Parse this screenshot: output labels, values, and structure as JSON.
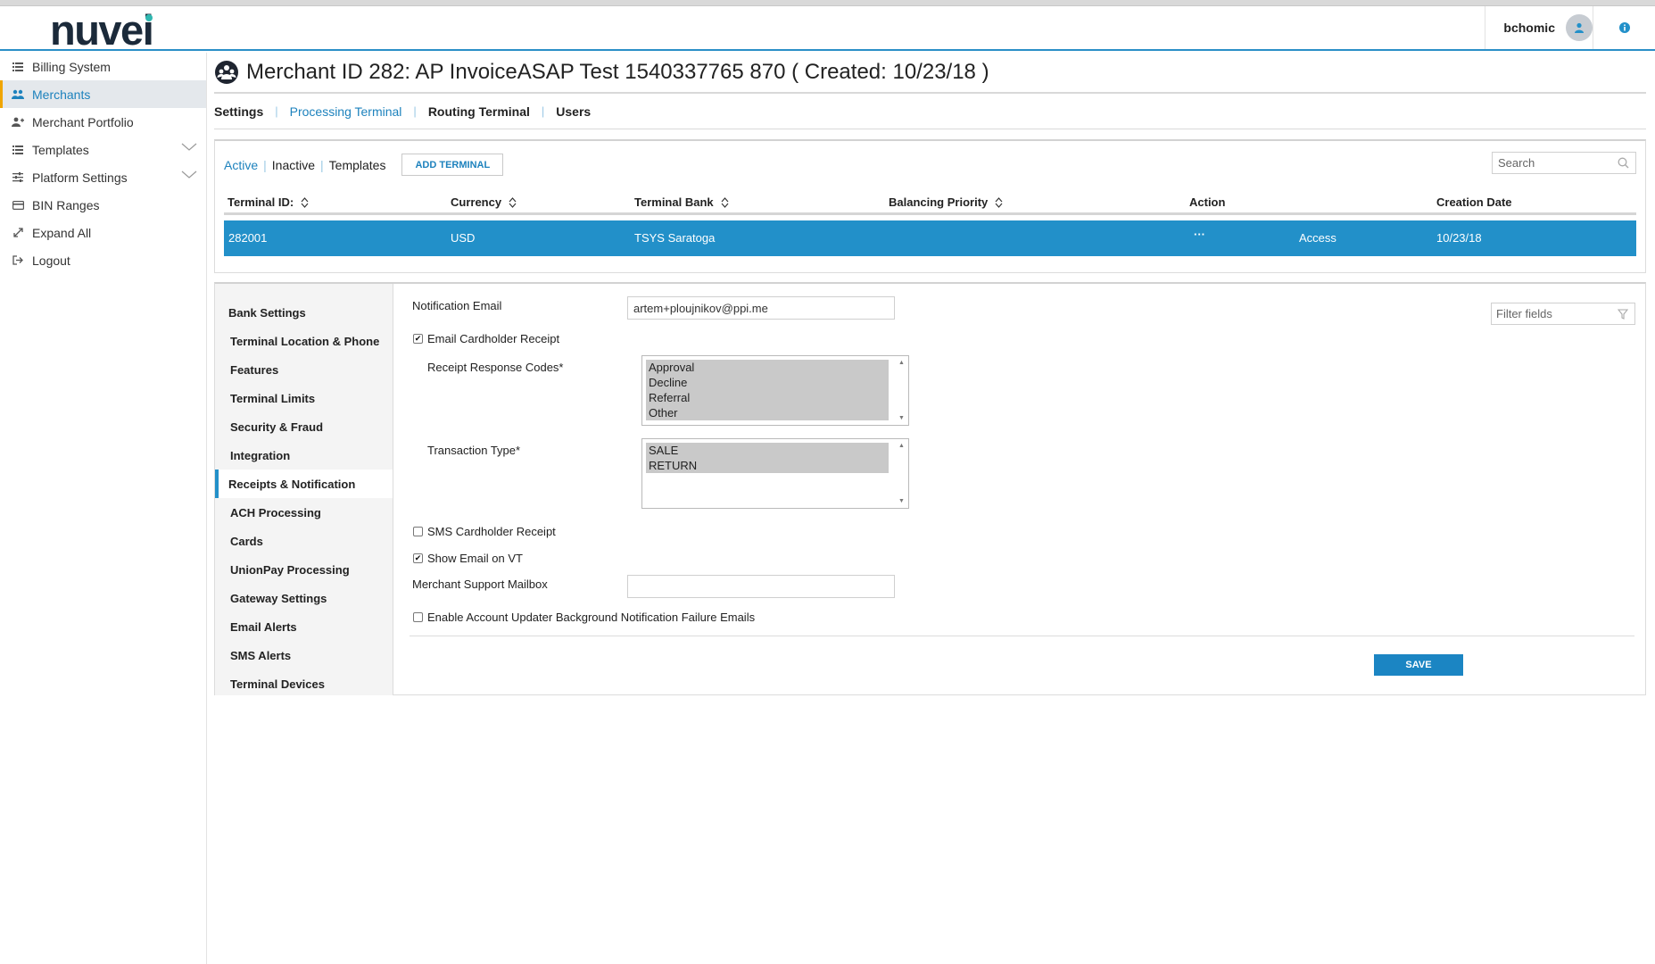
{
  "app": {
    "brand": "nuvei"
  },
  "header": {
    "username": "bchomic"
  },
  "sidebar": {
    "items": [
      {
        "label": "Billing System",
        "icon": "list-icon"
      },
      {
        "label": "Merchants",
        "icon": "users-icon"
      },
      {
        "label": "Merchant Portfolio",
        "icon": "user-add-icon"
      },
      {
        "label": "Templates",
        "icon": "list-icon"
      },
      {
        "label": "Platform Settings",
        "icon": "sliders-icon"
      },
      {
        "label": "BIN Ranges",
        "icon": "card-icon"
      },
      {
        "label": "Expand All",
        "icon": "expand-icon"
      },
      {
        "label": "Logout",
        "icon": "logout-icon"
      }
    ]
  },
  "page": {
    "title": "Merchant ID 282: AP InvoiceASAP Test 1540337765 870 ( Created: 10/23/18 )",
    "tabs": [
      "Settings",
      "Processing Terminal",
      "Routing Terminal",
      "Users"
    ]
  },
  "terminals": {
    "subtabs": [
      "Active",
      "Inactive",
      "Templates"
    ],
    "add_button": "ADD TERMINAL",
    "search_placeholder": "Search",
    "columns": [
      "Terminal ID:",
      "Currency",
      "Terminal Bank",
      "Balancing Priority",
      "Action",
      "Creation Date"
    ],
    "rows": [
      {
        "terminal_id": "282001",
        "currency": "USD",
        "bank": "TSYS Saratoga",
        "priority": "",
        "action_menu": "···",
        "action": "Access",
        "created": "10/23/18"
      }
    ]
  },
  "settings_nav": [
    "Bank Settings",
    "Terminal Location & Phone",
    "Features",
    "Terminal Limits",
    "Security & Fraud",
    "Integration",
    "Receipts & Notification",
    "ACH Processing",
    "Cards",
    "UnionPay Processing",
    "Gateway Settings",
    "Email Alerts",
    "SMS Alerts",
    "Terminal Devices"
  ],
  "form": {
    "notification_email_label": "Notification Email",
    "notification_email_value": "artem+ploujnikov@ppi.me",
    "email_cardholder_receipt_label": "Email Cardholder Receipt",
    "email_cardholder_receipt_checked": true,
    "receipt_codes_label": "Receipt Response Codes*",
    "receipt_codes": [
      "Approval",
      "Decline",
      "Referral",
      "Other"
    ],
    "transaction_type_label": "Transaction Type*",
    "transaction_types": [
      "SALE",
      "RETURN"
    ],
    "sms_receipt_label": "SMS Cardholder Receipt",
    "sms_receipt_checked": false,
    "show_email_vt_label": "Show Email on VT",
    "show_email_vt_checked": true,
    "support_mailbox_label": "Merchant Support Mailbox",
    "support_mailbox_value": "",
    "account_updater_label": "Enable Account Updater Background Notification Failure Emails",
    "account_updater_checked": false,
    "filter_placeholder": "Filter fields",
    "save_label": "SAVE"
  },
  "colors": {
    "accent": "#2290c9",
    "highlight": "#f0a500"
  }
}
